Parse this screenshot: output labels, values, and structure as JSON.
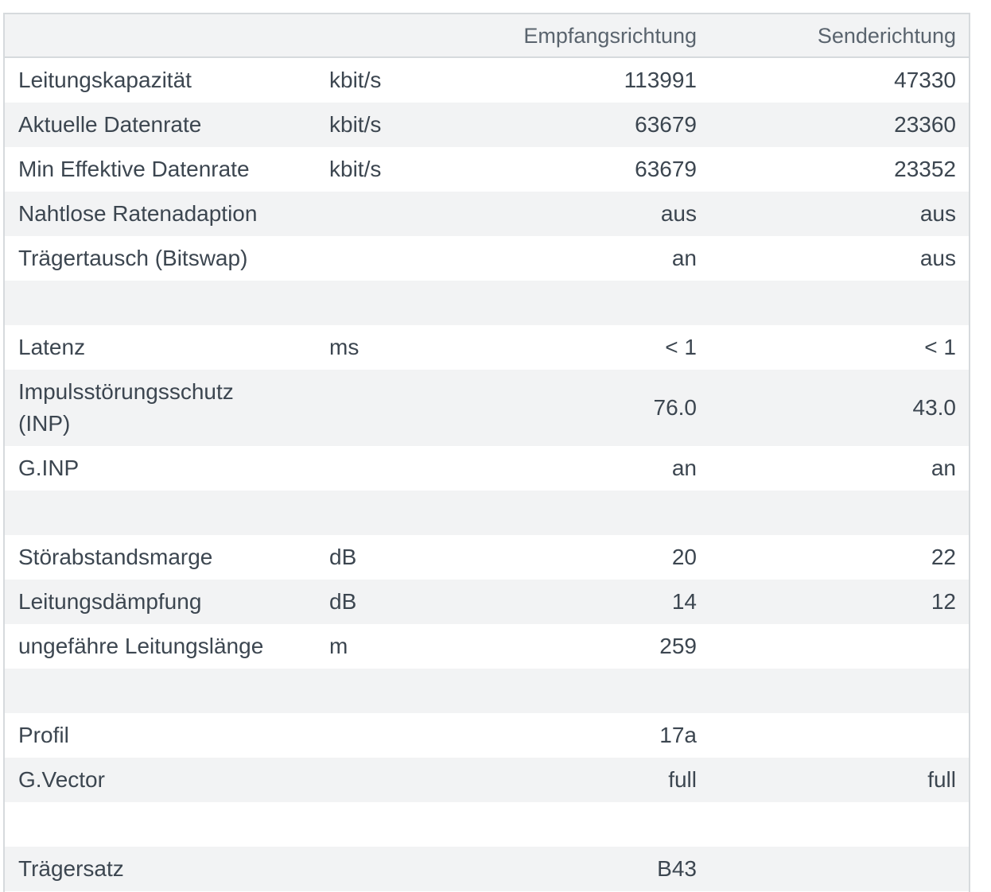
{
  "header": {
    "label": "",
    "unit": "",
    "down": "Empfangsrichtung",
    "up": "Senderichtung"
  },
  "rows": [
    {
      "label": "Leitungskapazität",
      "unit": "kbit/s",
      "down": "113991",
      "up": "47330"
    },
    {
      "label": "Aktuelle Datenrate",
      "unit": "kbit/s",
      "down": "63679",
      "up": "23360"
    },
    {
      "label": "Min Effektive Datenrate",
      "unit": "kbit/s",
      "down": "63679",
      "up": "23352"
    },
    {
      "label": "Nahtlose Ratenadaption",
      "unit": "",
      "down": "aus",
      "up": "aus"
    },
    {
      "label": "Trägertausch (Bitswap)",
      "unit": "",
      "down": "an",
      "up": "aus"
    },
    {
      "label": "",
      "unit": "",
      "down": "",
      "up": ""
    },
    {
      "label": "Latenz",
      "unit": "ms",
      "down": "< 1",
      "up": "< 1"
    },
    {
      "label": "Impulsstörungsschutz (INP)",
      "unit": "",
      "down": "76.0",
      "up": "43.0"
    },
    {
      "label": "G.INP",
      "unit": "",
      "down": "an",
      "up": "an"
    },
    {
      "label": "",
      "unit": "",
      "down": "",
      "up": ""
    },
    {
      "label": "Störabstandsmarge",
      "unit": "dB",
      "down": "20",
      "up": "22"
    },
    {
      "label": "Leitungsdämpfung",
      "unit": "dB",
      "down": "14",
      "up": "12"
    },
    {
      "label": "ungefähre Leitungslänge",
      "unit": "m",
      "down": "259",
      "up": ""
    },
    {
      "label": "",
      "unit": "",
      "down": "",
      "up": ""
    },
    {
      "label": "Profil",
      "unit": "",
      "down": "17a",
      "up": ""
    },
    {
      "label": "G.Vector",
      "unit": "",
      "down": "full",
      "up": "full"
    },
    {
      "label": "",
      "unit": "",
      "down": "",
      "up": ""
    },
    {
      "label": "Trägersatz",
      "unit": "",
      "down": "B43",
      "up": ""
    }
  ]
}
